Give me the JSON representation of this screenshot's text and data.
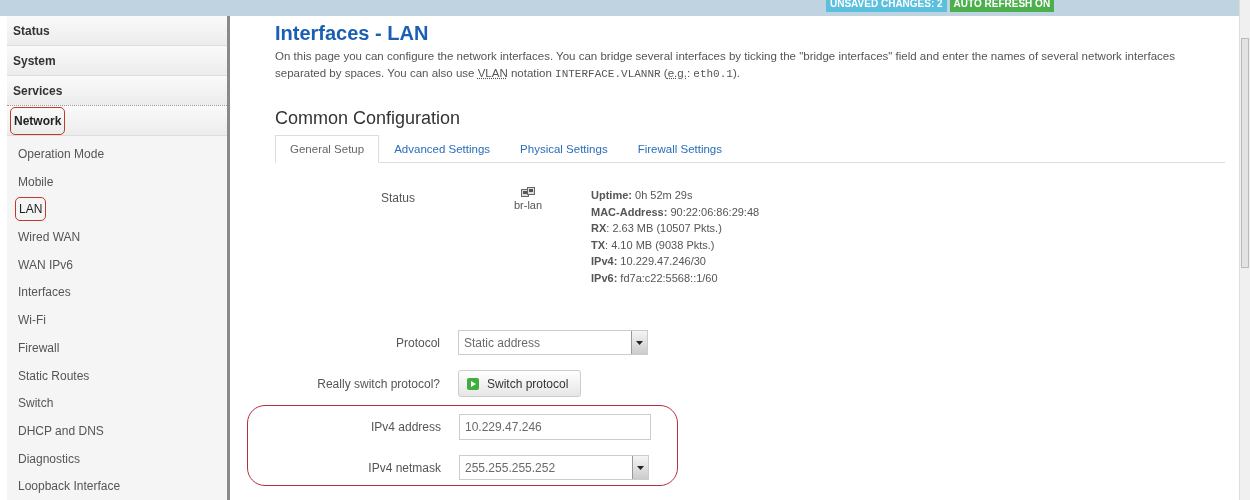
{
  "header": {
    "badges": [
      {
        "label": "UNSAVED CHANGES: 2",
        "kind": "changes"
      },
      {
        "label": "AUTO REFRESH ON",
        "kind": "refresh"
      }
    ]
  },
  "sidebar": {
    "items": [
      {
        "label": "Status",
        "kind": "section",
        "selected": false,
        "annotated": false
      },
      {
        "label": "System",
        "kind": "section",
        "selected": false,
        "annotated": false
      },
      {
        "label": "Services",
        "kind": "section",
        "selected": false,
        "annotated": false
      },
      {
        "label": "Network",
        "kind": "section",
        "selected": true,
        "annotated": true
      },
      {
        "label": "Operation Mode",
        "kind": "link",
        "selected": false,
        "annotated": false
      },
      {
        "label": "Mobile",
        "kind": "link",
        "selected": false,
        "annotated": false
      },
      {
        "label": "LAN",
        "kind": "link",
        "selected": true,
        "annotated": true
      },
      {
        "label": "Wired WAN",
        "kind": "link",
        "selected": false,
        "annotated": false
      },
      {
        "label": "WAN IPv6",
        "kind": "link",
        "selected": false,
        "annotated": false
      },
      {
        "label": "Interfaces",
        "kind": "link",
        "selected": false,
        "annotated": false
      },
      {
        "label": "Wi-Fi",
        "kind": "link",
        "selected": false,
        "annotated": false
      },
      {
        "label": "Firewall",
        "kind": "link",
        "selected": false,
        "annotated": false
      },
      {
        "label": "Static Routes",
        "kind": "link",
        "selected": false,
        "annotated": false
      },
      {
        "label": "Switch",
        "kind": "link",
        "selected": false,
        "annotated": false
      },
      {
        "label": "DHCP and DNS",
        "kind": "link",
        "selected": false,
        "annotated": false
      },
      {
        "label": "Diagnostics",
        "kind": "link",
        "selected": false,
        "annotated": false
      },
      {
        "label": "Loopback Interface",
        "kind": "link",
        "selected": false,
        "annotated": false
      }
    ]
  },
  "page": {
    "title": "Interfaces - LAN",
    "description": [
      {
        "kind": "text",
        "text": "On this page you can configure the network interfaces. You can bridge several interfaces by ticking the \"bridge interfaces\" field and enter the names of several network interfaces separated by spaces. You can also use "
      },
      {
        "kind": "abbr",
        "text": "VLAN"
      },
      {
        "kind": "text",
        "text": " notation "
      },
      {
        "kind": "code",
        "text": "INTERFACE.VLANNR"
      },
      {
        "kind": "text",
        "text": " ("
      },
      {
        "kind": "abbr",
        "text": "e.g."
      },
      {
        "kind": "text",
        "text": ": "
      },
      {
        "kind": "code",
        "text": "eth0.1"
      },
      {
        "kind": "text",
        "text": ")."
      }
    ],
    "section_title": "Common Configuration",
    "tabs": [
      {
        "label": "General Setup",
        "selected": true
      },
      {
        "label": "Advanced Settings",
        "selected": false
      },
      {
        "label": "Physical Settings",
        "selected": false
      },
      {
        "label": "Firewall Settings",
        "selected": false
      }
    ],
    "status": {
      "label": "Status",
      "interface": "br-lan",
      "lines": [
        "**Uptime:** 0h 52m 29s",
        "**MAC-Address:** 90:22:06:86:29:48",
        "**RX**: 2.63 MB (10507 Pkts.)",
        "**TX**: 4.10 MB (9038 Pkts.)",
        "**IPv4:** 10.229.47.246/30",
        "**IPv6:** fd7a:c22:5568::1/60"
      ]
    },
    "fields": [
      {
        "label": "Protocol",
        "kind": "select",
        "value": "Static address",
        "annotated": false
      },
      {
        "label": "Really switch protocol?",
        "kind": "button",
        "value": "Switch protocol",
        "annotated": false
      },
      {
        "label": "IPv4 address",
        "kind": "text",
        "value": "10.229.47.246",
        "annotated": true
      },
      {
        "label": "IPv4 netmask",
        "kind": "select",
        "value": "255.255.255.252",
        "annotated": true
      }
    ]
  }
}
